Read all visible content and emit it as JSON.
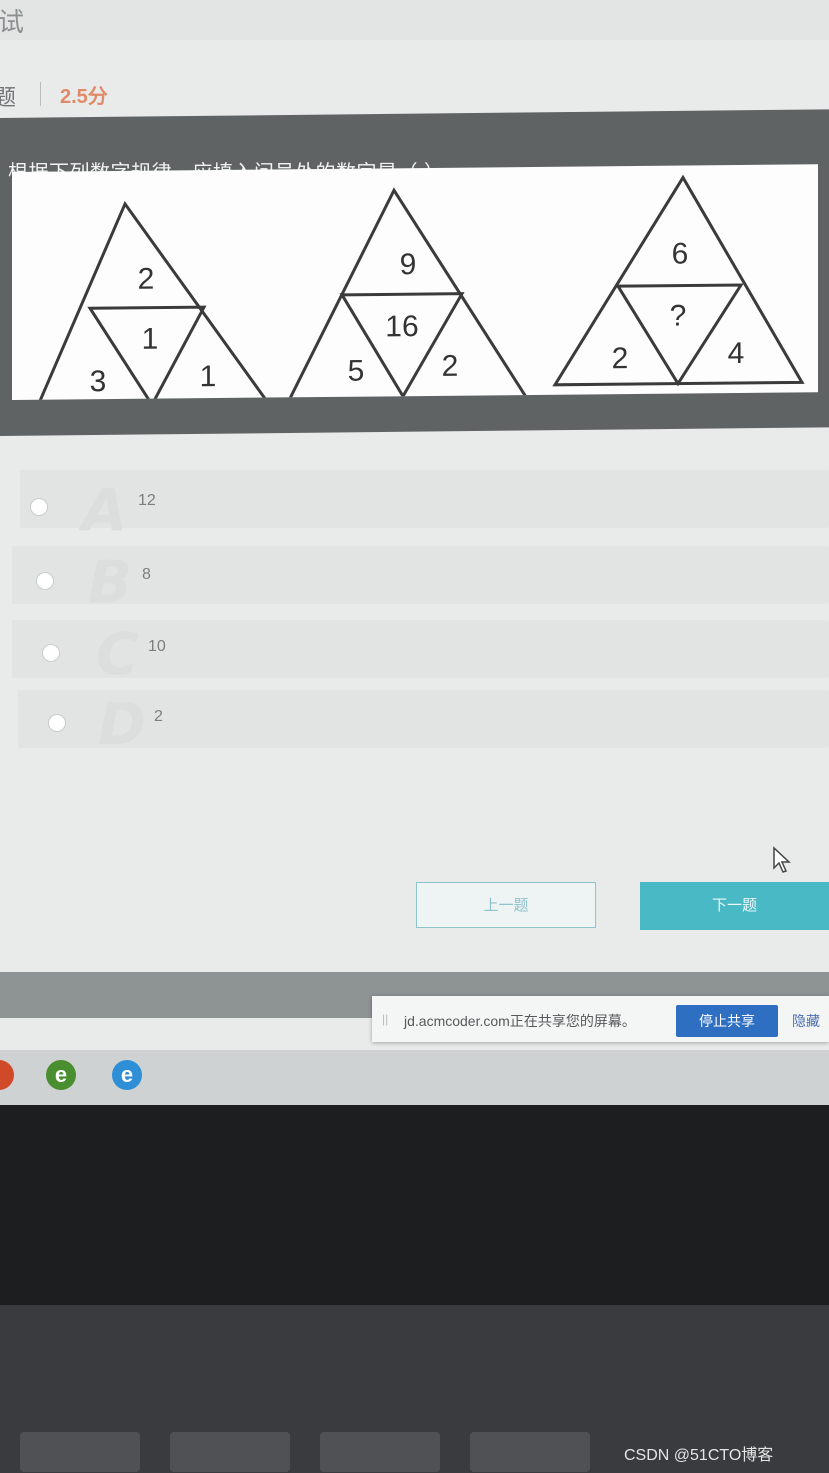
{
  "header": {
    "title_fragment": "试"
  },
  "question_meta": {
    "type_fragment": "题",
    "score": "2.5分"
  },
  "question": {
    "text": "根据下列数字规律，应填入问号处的数字是（  ）。"
  },
  "figure": {
    "triangles": [
      {
        "top": "2",
        "center": "1",
        "left": "3",
        "right": "1"
      },
      {
        "top": "9",
        "center": "16",
        "left": "5",
        "right": "2"
      },
      {
        "top": "6",
        "center": "?",
        "left": "2",
        "right": "4"
      }
    ]
  },
  "options": [
    {
      "letter": "A",
      "value": "12"
    },
    {
      "letter": "B",
      "value": "8"
    },
    {
      "letter": "C",
      "value": "10"
    },
    {
      "letter": "D",
      "value": "2"
    }
  ],
  "nav": {
    "prev_label": "上一题",
    "next_label": "下一题"
  },
  "share_bar": {
    "message": "jd.acmcoder.com正在共享您的屏幕。",
    "stop_label": "停止共享",
    "hide_label": "隐藏"
  },
  "watermark": "CSDN @51CTO博客",
  "colors": {
    "accent": "#49b9c6",
    "score": "#e08a68",
    "share_button": "#2f6fc2"
  }
}
